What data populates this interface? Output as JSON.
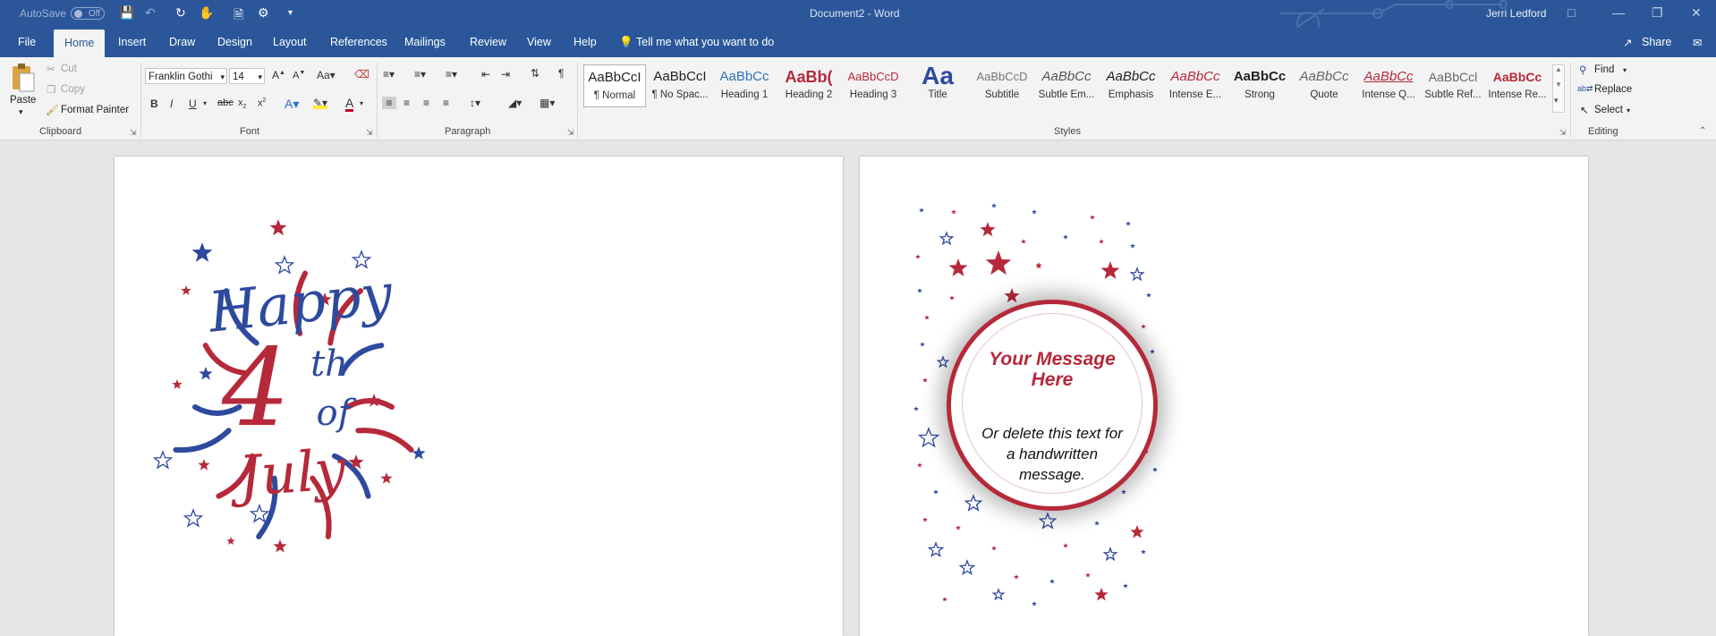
{
  "titlebar": {
    "autosave_label": "AutoSave",
    "autosave_state": "Off",
    "doc_title": "Document2  -  Word",
    "user": "Jerri Ledford",
    "bg_color": "#2b579a"
  },
  "tabs": [
    "File",
    "Home",
    "Insert",
    "Draw",
    "Design",
    "Layout",
    "References",
    "Mailings",
    "Review",
    "View",
    "Help"
  ],
  "tell_me": "Tell me what you want to do",
  "share": "Share",
  "clipboard": {
    "paste": "Paste",
    "cut": "Cut",
    "copy": "Copy",
    "format_painter": "Format Painter",
    "group": "Clipboard"
  },
  "font": {
    "name": "Franklin Gothi",
    "size": "14",
    "group": "Font"
  },
  "paragraph": {
    "group": "Paragraph"
  },
  "styles": {
    "group": "Styles",
    "items": [
      {
        "preview": "AaBbCcI",
        "name": "¶ Normal"
      },
      {
        "preview": "AaBbCcI",
        "name": "¶ No Spac..."
      },
      {
        "preview": "AaBbCc",
        "name": "Heading 1"
      },
      {
        "preview": "AaBb(",
        "name": "Heading 2"
      },
      {
        "preview": "AaBbCcD",
        "name": "Heading 3"
      },
      {
        "preview": "Aa",
        "name": "Title"
      },
      {
        "preview": "AaBbCcD",
        "name": "Subtitle"
      },
      {
        "preview": "AaBbCc",
        "name": "Subtle Em..."
      },
      {
        "preview": "AaBbCc",
        "name": "Emphasis"
      },
      {
        "preview": "AaBbCc",
        "name": "Intense E..."
      },
      {
        "preview": "AaBbCc",
        "name": "Strong"
      },
      {
        "preview": "AaBbCc",
        "name": "Quote"
      },
      {
        "preview": "AaBbCc",
        "name": "Intense Q..."
      },
      {
        "preview": "AaBbCcl",
        "name": "Subtle Ref..."
      },
      {
        "preview": "AaBbCc",
        "name": "Intense Re..."
      }
    ]
  },
  "editing": {
    "find": "Find",
    "replace": "Replace",
    "select": "Select",
    "group": "Editing"
  },
  "page1": {
    "line1": "Happy",
    "line2": "4",
    "line3": "th",
    "line4": "of",
    "line5": "July"
  },
  "page2": {
    "title": "Your Message Here",
    "body": "Or delete this text for a handwritten message."
  },
  "colors": {
    "red": "#b5293a",
    "blue": "#2e4a9e"
  }
}
